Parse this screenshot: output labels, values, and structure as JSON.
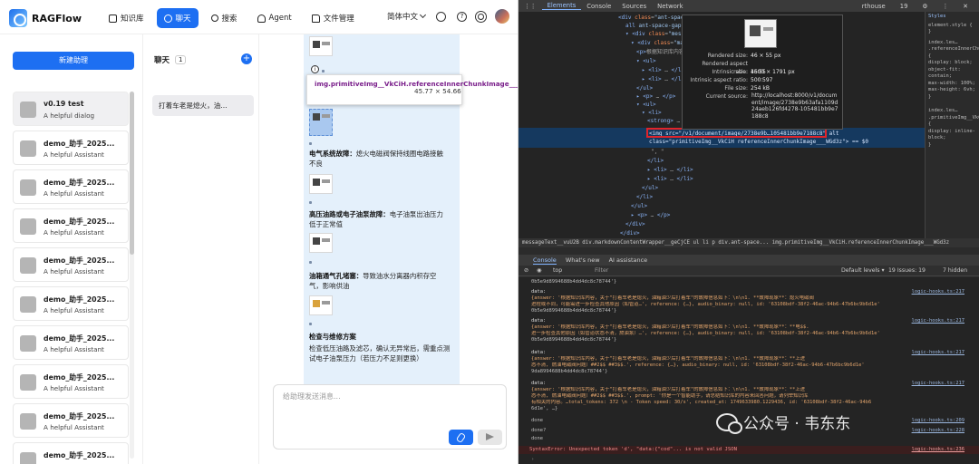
{
  "app": {
    "logo": "RAGFlow",
    "nav": [
      {
        "label": "知识库"
      },
      {
        "label": "聊天"
      },
      {
        "label": "搜索"
      },
      {
        "label": "Agent"
      },
      {
        "label": "文件管理"
      }
    ],
    "lang": "简体中文",
    "new_button": "新建助理",
    "assistants": [
      {
        "name": "v0.19 test",
        "desc": "A helpful dialog"
      },
      {
        "name": "demo_助手_2025...",
        "desc": "A helpful Assistant"
      },
      {
        "name": "demo_助手_2025...",
        "desc": "A helpful Assistant"
      },
      {
        "name": "demo_助手_2025...",
        "desc": "A helpful Assistant"
      },
      {
        "name": "demo_助手_2025...",
        "desc": "A helpful Assistant"
      },
      {
        "name": "demo_助手_2025...",
        "desc": "A helpful Assistant"
      },
      {
        "name": "demo_助手_2025...",
        "desc": "A helpful Assistant"
      },
      {
        "name": "demo_助手_2025...",
        "desc": "A helpful Assistant"
      },
      {
        "name": "demo_助手_2025...",
        "desc": "A helpful Assistant"
      },
      {
        "name": "demo_助手_2025...",
        "desc": ""
      }
    ],
    "chats": {
      "title": "聊天",
      "count": "1",
      "items": [
        "打着车老是熄火，油..."
      ]
    },
    "message": {
      "tooltip_name": "img.primitiveImg__VkCiH.referenceInnerChunkImage___WGd3z",
      "tooltip_size": "45.77 × 54.66",
      "p1": "电气系统故障：",
      "p1b": "熄火电磁阀保持线圈电路接触不良",
      "p2": "高压油路或电子油泵故障：",
      "p2b": "电子油泵出油压力低于正常值",
      "p3": "油箱通气孔堵塞：",
      "p3b": "导致油水分离器内积存空气，影响供油",
      "p4": "检查与维修方案",
      "p4b": "检查低压油路及滤芯，确认无异常后，需重点测试电子油泵压力（若压力不足则更换）"
    },
    "input_placeholder": "给助理发送消息..."
  },
  "devtools": {
    "tabs": [
      "Elements",
      "Console",
      "Sources",
      "Network"
    ],
    "tabs_right": "rthouse",
    "issues_badge": "19",
    "popup": {
      "rendered_size": "46 × 55 px",
      "rendered_aspect": "46∶55",
      "intrinsic_size": "1500 × 1791 px",
      "intrinsic_aspect": "500∶597",
      "file_size": "254 kB",
      "current_source": "http://localhost:8000/v1/document/image/2738e9b63afa1109d24aeb126fd4278-105481bb9e7188c8"
    },
    "popup_labels": [
      "Rendered size:",
      "Rendered aspect ratio:",
      "Intrinsic size:",
      "Intrinsic aspect ratio:",
      "File size:",
      "Current source:"
    ],
    "selected_node": "<img src=\"/v1/document/image/2738e9b…105481bb9e7188c8\" alt class=\"primitiveImg__VkCiH referenceInnerChunkImage___WGd3z\"> == $0",
    "breadcrumb": "messageText__vuU2B  div.markdownContentWrapper__geCjCE  ul  li  p  div.ant-space...  img.primitiveImg__VkCiH.referenceInnerChunkImage___WGd3z",
    "console_tabs": [
      "Console",
      "What's new",
      "AI assistance"
    ],
    "console_top": "top",
    "console_filter": "Filter",
    "default_levels": "Default levels ▾",
    "issues_count": "19 Issues: 19",
    "hidden_count": "7 hidden",
    "source_link": "logic-hooks.ts:217",
    "source_link2": "logic-hooks.ts:209",
    "source_link3": "logic-hooks.ts:228",
    "source_link4": "logic-hooks.ts:236",
    "done": "done",
    "done_q": "done?",
    "error": "SyntaxError: Unexpected token 'd', \"data:{\"cod\"... is not valid JSON",
    "styles_title": "Styles",
    "watermark": "公众号 · 韦东东"
  },
  "colors": {
    "accent": "#1d6ff2",
    "bubble": "#e4f0fb",
    "highlight_box": "#e0242a"
  }
}
